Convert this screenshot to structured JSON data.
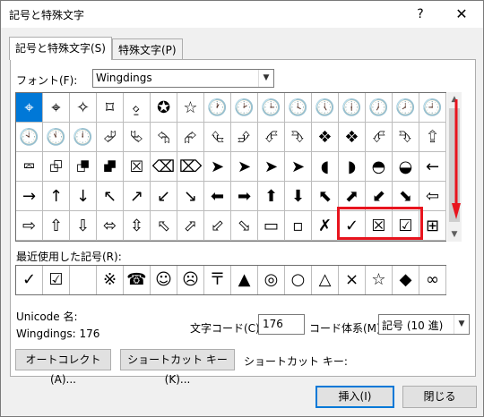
{
  "window": {
    "title": "記号と特殊文字",
    "help_icon": "?",
    "close_icon": "✕"
  },
  "tabs": [
    {
      "label": "記号と特殊文字(S)",
      "active": true
    },
    {
      "label": "特殊文字(P)",
      "active": false
    }
  ],
  "font": {
    "label": "フォント(F):",
    "value": "Wingdings"
  },
  "grid": {
    "rows": [
      [
        "⌖",
        "⌖",
        "✧",
        "⌑",
        "⍚",
        "✪",
        "☆",
        "🕐",
        "🕑",
        "🕒",
        "🕓",
        "🕔",
        "🕕",
        "🕖",
        "🕗",
        "🕘"
      ],
      [
        "🕙",
        "🕚",
        "🕛",
        "⮰",
        "⮱",
        "⮲",
        "⮳",
        "⮴",
        "⮵",
        "⮶",
        "⮷",
        "❖",
        "❖",
        "⮶",
        "⮷",
        "⮸"
      ],
      [
        "⮹",
        "⮺",
        "⮻",
        "⮼",
        "⮽",
        "⌫",
        "⌦",
        "➤",
        "➤",
        "➤",
        "➤",
        "◖",
        "◗",
        "◓",
        "◒",
        "←"
      ],
      [
        "→",
        "↑",
        "↓",
        "↖",
        "↗",
        "↙",
        "↘",
        "⬅",
        "➡",
        "⬆",
        "⬇",
        "⬉",
        "⬈",
        "⬋",
        "⬊",
        "⇦"
      ],
      [
        "⇨",
        "⇧",
        "⇩",
        "⬄",
        "⇳",
        "⬁",
        "⬀",
        "⬃",
        "⬂",
        "▭",
        "▫",
        "✗",
        "✓",
        "☒",
        "☑",
        "⊞"
      ]
    ],
    "selected_index": 0,
    "highlight_color": "#e8141e",
    "selection_color": "#0078d7"
  },
  "recent": {
    "label": "最近使用した記号(R):",
    "items": [
      "✓",
      "☑",
      "",
      "※",
      "☎",
      "☺",
      "☹",
      "〒",
      "▲",
      "◎",
      "○",
      "△",
      "×",
      "☆",
      "◆",
      "∞"
    ]
  },
  "info": {
    "unicode_label": "Unicode 名:",
    "char_name": "Wingdings: 176",
    "code_label": "文字コード(C):",
    "code_value": "176",
    "system_label": "コード体系(M):",
    "system_value": "記号 (10 進)"
  },
  "buttons": {
    "autocorrect": "オートコレクト(A)...",
    "shortcut": "ショートカット キー(K)...",
    "shortcut_label": "ショートカット キー:",
    "insert": "挿入(I)",
    "close": "閉じる"
  }
}
